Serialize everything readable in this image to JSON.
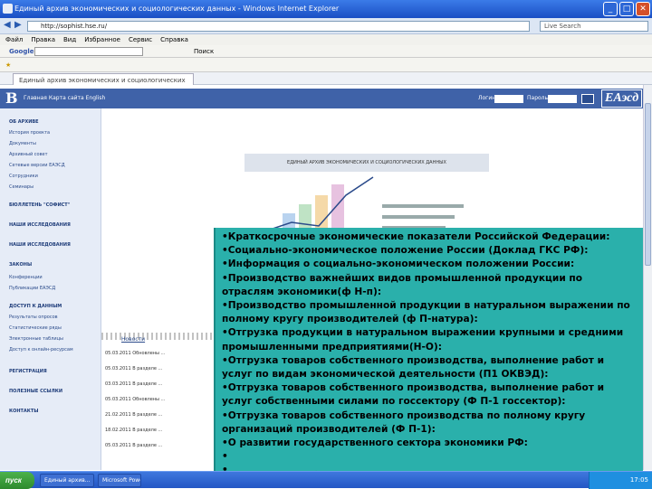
{
  "browser": {
    "title": "Единый архив экономических и социологических данных - Windows Internet Explorer",
    "address": "http://sophist.hse.ru/",
    "search_placeholder": "Live Search",
    "menu": [
      "Файл",
      "Правка",
      "Вид",
      "Избранное",
      "Сервис",
      "Справка"
    ],
    "google_label": "Google",
    "google_search": "Поиск",
    "tab_title": "Единый архив экономических и социологических данных"
  },
  "site": {
    "langs": "Главная   Карта сайта   English",
    "login_label": "Логин",
    "password_label": "Пароль",
    "brand": "ЕАэсд",
    "banner": "ЕДИНЫЙ АРХИВ ЭКОНОМИЧЕСКИХ И СОЦИОЛОГИЧЕСКИХ ДАННЫХ",
    "sidebar": [
      {
        "text": "ОБ АРХИВЕ",
        "head": true
      },
      {
        "text": "История проекта",
        "head": false
      },
      {
        "text": "Документы",
        "head": false
      },
      {
        "text": "Архивный совет",
        "head": false
      },
      {
        "text": "Сетевые версии ЕАЭСД",
        "head": false
      },
      {
        "text": "Сотрудники",
        "head": false
      },
      {
        "text": "Семинары",
        "head": false
      },
      {
        "text": "БЮЛЛЕТЕНЬ \"СОФИСТ\"",
        "head": true
      },
      {
        "text": "НАШИ ИССЛЕДОВАНИЯ",
        "head": true
      },
      {
        "text": "НАШИ ИССЛЕДОВАНИЯ",
        "head": true
      },
      {
        "text": "ЗАКОНЫ",
        "head": true
      },
      {
        "text": "Конференции",
        "head": false
      },
      {
        "text": "Публикации ЕАЭСД",
        "head": false
      },
      {
        "text": "ДОСТУП К ДАННЫМ",
        "head": true
      },
      {
        "text": "Результаты опросов",
        "head": false
      },
      {
        "text": "Статистические ряды",
        "head": false
      },
      {
        "text": "Электронные таблицы",
        "head": false
      },
      {
        "text": "Доступ к онлайн-ресурсам",
        "head": false
      },
      {
        "text": "РЕГИСТРАЦИЯ",
        "head": true
      },
      {
        "text": "ПОЛЕЗНЫЕ ССЫЛКИ",
        "head": true
      },
      {
        "text": "КОНТАКТЫ",
        "head": true
      }
    ],
    "news_tab": "Новости",
    "news": [
      "05.03.2011 Обновлены ...",
      "05.03.2011 В разделе ...",
      "03.03.2011 В разделе ...",
      "05.03.2011 Обновлены ...",
      "21.02.2011 В разделе ...",
      "18.02.2011 В разделе ...",
      "05.03.2011 В разделе ..."
    ]
  },
  "overlay_lines": [
    "•Краткосрочные экономические показатели Российской Федерации:",
    "•Социально-экономическое положение России (Доклад ГКС РФ):",
    "•Информация о социально-экономическом положении России:",
    "•Производство важнейших видов промышленной продукции по отраслям экономики(ф Н-п):",
    "•Производство промышленной продукции в натуральном выражении по полному кругу производителей (ф П-натура):",
    "•Отгрузка продукции в натуральном выражении крупными и средними промышленными предприятиями(Н-О):",
    "•Отгрузка товаров собственного производства, выполнение работ и услуг по видам экономической деятельности (П1 ОКВЭД):",
    "•Отгрузка товаров собственного производства, выполнение работ и услуг собственными силами по госсектору (Ф П-1 госсектор):",
    "•Отгрузка товаров собственного производства по полному кругу организаций производителей (Ф П-1):",
    "•О развитии государственного сектора экономики РФ:",
    "•",
    "•………………………."
  ],
  "taskbar": {
    "start": "пуск",
    "tasks": [
      "Единый архив...",
      "Microsoft PowerPoint..."
    ],
    "clock": "17:05"
  }
}
